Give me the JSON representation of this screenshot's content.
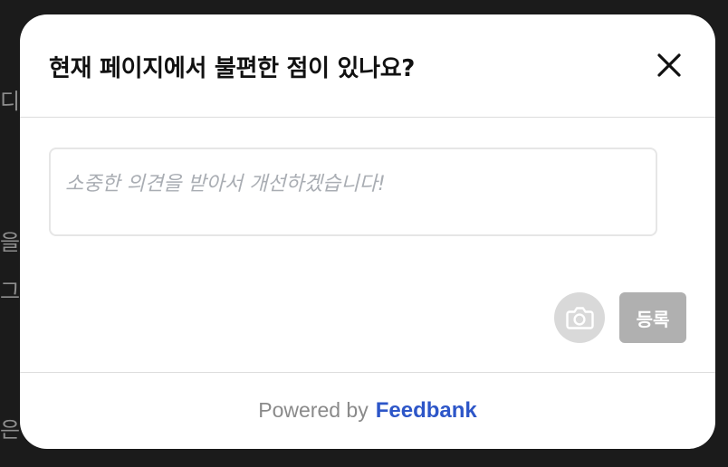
{
  "background": {
    "fragments": [
      "디거",
      "을 더",
      "그",
      "은 더"
    ]
  },
  "modal": {
    "title": "현재 페이지에서 불편한 점이 있나요?",
    "close_icon": "close-icon",
    "textarea": {
      "value": "",
      "placeholder": "소중한 의견을 받아서 개선하겠습니다!"
    },
    "camera_icon": "camera-icon",
    "submit_label": "등록",
    "footer": {
      "powered_label": "Powered by",
      "brand_name": "Feedbank"
    }
  },
  "colors": {
    "backdrop": "#1b1b1b",
    "brand": "#2d56c8",
    "disabled_button": "#b0b0b0",
    "camera_button": "#d9d9d9"
  }
}
